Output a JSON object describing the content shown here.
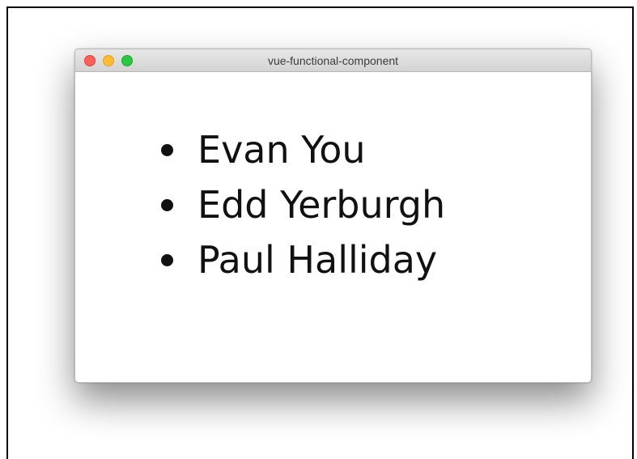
{
  "window": {
    "title": "vue-functional-component",
    "controls": [
      {
        "name": "close",
        "color": "#fe5f57"
      },
      {
        "name": "minimize",
        "color": "#febc2e"
      },
      {
        "name": "zoom",
        "color": "#28c840"
      }
    ]
  },
  "list": {
    "items": [
      "Evan You",
      "Edd Yerburgh",
      "Paul Halliday"
    ]
  }
}
